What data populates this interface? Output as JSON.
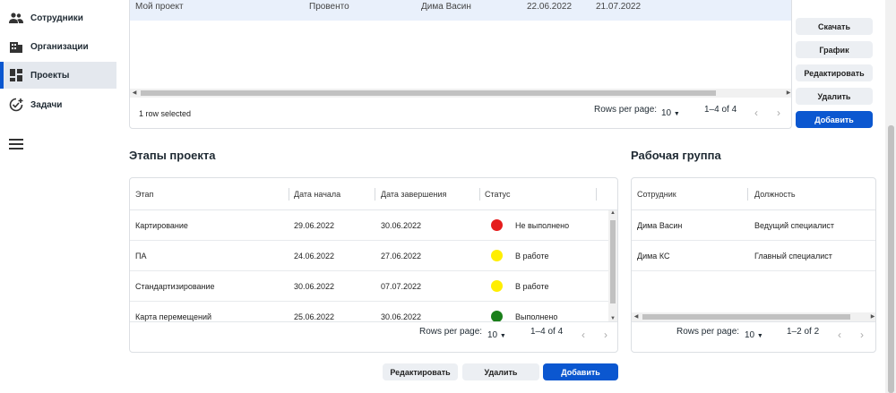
{
  "sidebar": {
    "items": [
      {
        "label": "Сотрудники",
        "icon": "people-icon",
        "active": false
      },
      {
        "label": "Организации",
        "icon": "building-icon",
        "active": false
      },
      {
        "label": "Проекты",
        "icon": "dashboard-icon",
        "active": true
      },
      {
        "label": "Задачи",
        "icon": "task-add-icon",
        "active": false
      }
    ],
    "menu_icon": "menu-icon"
  },
  "projects_grid": {
    "selected_row": [
      "Мой проект",
      "Провенто",
      "Дима Васин",
      "22.06.2022",
      "21.07.2022"
    ],
    "footer_status": "1 row selected",
    "rows_per_page_label": "Rows per page:",
    "rows_per_page_value": "10",
    "range": "1–4 of 4"
  },
  "project_actions": {
    "download": "Скачать",
    "chart": "График",
    "edit": "Редактировать",
    "delete": "Удалить",
    "add": "Добавить"
  },
  "stages": {
    "title": "Этапы проекта",
    "columns": [
      "Этап",
      "Дата начала",
      "Дата завершения",
      "Статус"
    ],
    "rows": [
      {
        "name": "Картирование",
        "start": "29.06.2022",
        "end": "30.06.2022",
        "status": "Не выполнено",
        "color": "#e51c1c"
      },
      {
        "name": "ПА",
        "start": "24.06.2022",
        "end": "27.06.2022",
        "status": "В работе",
        "color": "#ffee00"
      },
      {
        "name": "Стандартизирование",
        "start": "30.06.2022",
        "end": "07.07.2022",
        "status": "В работе",
        "color": "#ffee00"
      },
      {
        "name": "Карта перемещений",
        "start": "25.06.2022",
        "end": "30.06.2022",
        "status": "Выполнено",
        "color": "#1a7f1a"
      }
    ],
    "rows_per_page_label": "Rows per page:",
    "rows_per_page_value": "10",
    "range": "1–4 of 4"
  },
  "stage_actions": {
    "edit": "Редактировать",
    "delete": "Удалить",
    "add": "Добавить"
  },
  "workgroup": {
    "title": "Рабочая группа",
    "columns": [
      "Сотрудник",
      "Должность"
    ],
    "rows": [
      {
        "employee": "Дима Васин",
        "position": "Ведущий специалист"
      },
      {
        "employee": "Дима КС",
        "position": "Главный специалист"
      }
    ],
    "rows_per_page_label": "Rows per page:",
    "rows_per_page_value": "10",
    "range": "1–2 of 2"
  },
  "colors": {
    "accent": "#0b57d0",
    "selected_row": "#e9f0fb"
  }
}
